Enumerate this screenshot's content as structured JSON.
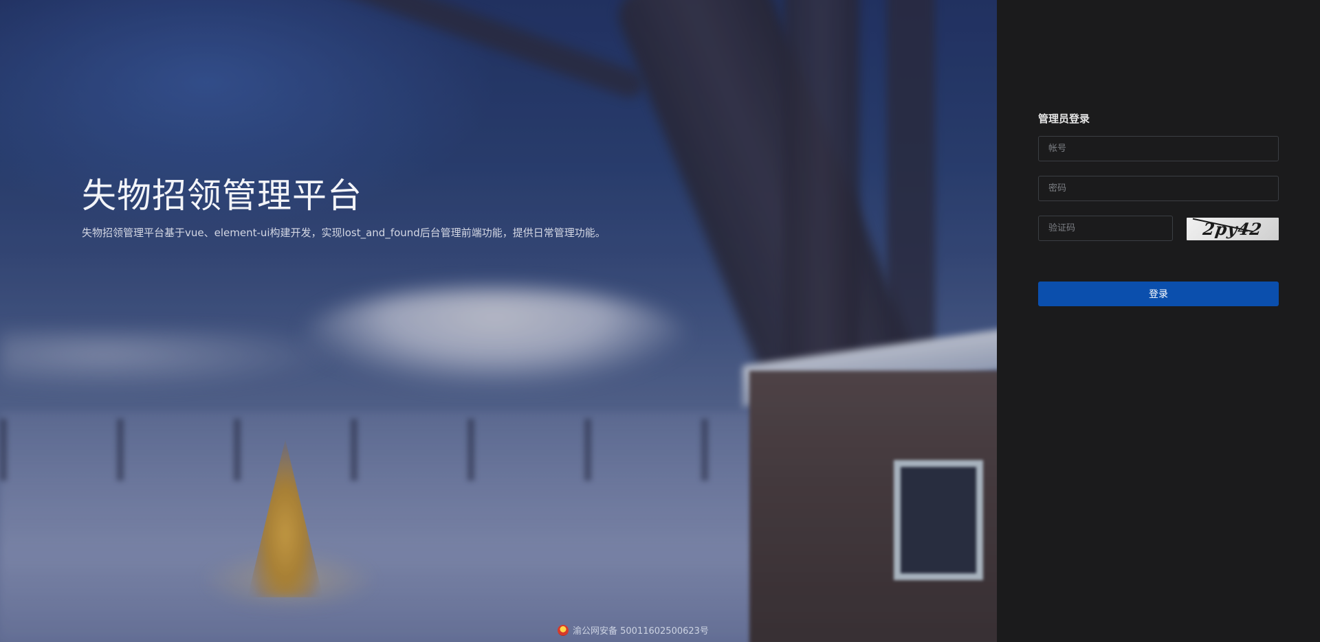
{
  "hero": {
    "title": "失物招领管理平台",
    "description": "失物招领管理平台基于vue、element-ui构建开发，实现lost_and_found后台管理前端功能，提供日常管理功能。"
  },
  "footer": {
    "icon": "police-badge-icon",
    "text": "渝公网安备 50011602500623号"
  },
  "login": {
    "title": "管理员登录",
    "account": {
      "value": "",
      "placeholder": "帐号"
    },
    "password": {
      "value": "",
      "placeholder": "密码"
    },
    "captcha": {
      "value": "",
      "placeholder": "验证码",
      "image_text": "2py42"
    },
    "submit_label": "登录"
  },
  "colors": {
    "button": "#0b4fad",
    "panel": "#1b1b1c",
    "field_border": "#3c3f44"
  }
}
